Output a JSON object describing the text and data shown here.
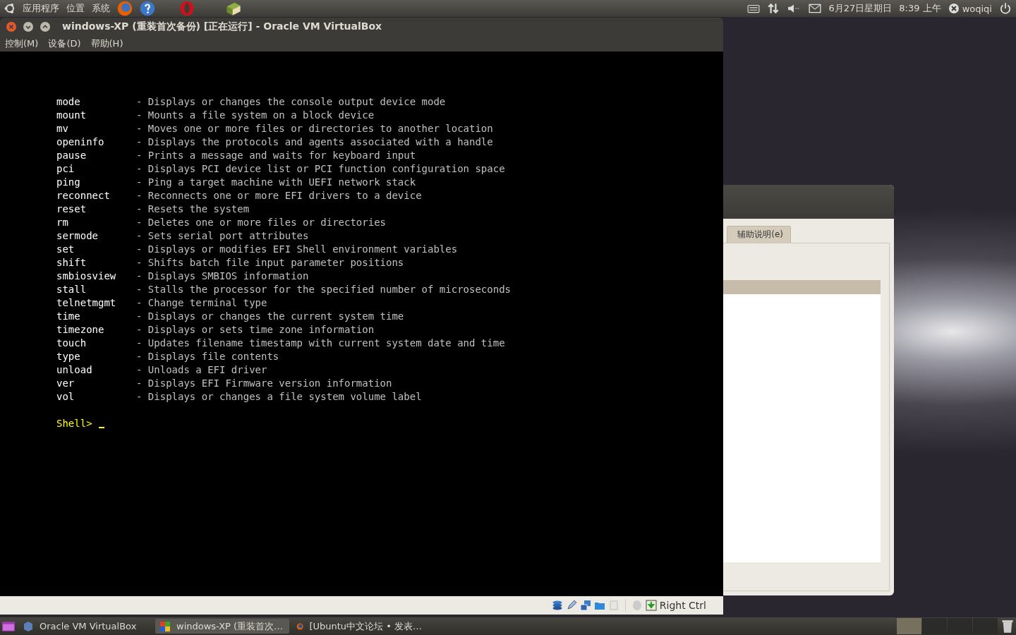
{
  "top_panel": {
    "menus": [
      "应用程序",
      "位置",
      "系统"
    ],
    "date": "6月27日星期日",
    "time": "8:39 上午",
    "user": "woqiqi"
  },
  "window": {
    "title": "windows-XP (重装首次备份) [正在运行] - Oracle VM VirtualBox",
    "menu": [
      "控制(M)",
      "设备(D)",
      "帮助(H)"
    ],
    "console": {
      "rows": [
        {
          "command": "mode",
          "description": "- Displays or changes the console output device mode"
        },
        {
          "command": "mount",
          "description": "- Mounts a file system on a block device"
        },
        {
          "command": "mv",
          "description": "- Moves one or more files or directories to another location"
        },
        {
          "command": "openinfo",
          "description": "- Displays the protocols and agents associated with a handle"
        },
        {
          "command": "pause",
          "description": "- Prints a message and waits for keyboard input"
        },
        {
          "command": "pci",
          "description": "- Displays PCI device list or PCI function configuration space"
        },
        {
          "command": "ping",
          "description": "- Ping a target machine with UEFI network stack"
        },
        {
          "command": "reconnect",
          "description": "- Reconnects one or more EFI drivers to a device"
        },
        {
          "command": "reset",
          "description": "- Resets the system"
        },
        {
          "command": "rm",
          "description": "- Deletes one or more files or directories"
        },
        {
          "command": "sermode",
          "description": "- Sets serial port attributes"
        },
        {
          "command": "set",
          "description": "- Displays or modifies EFI Shell environment variables"
        },
        {
          "command": "shift",
          "description": "- Shifts batch file input parameter positions"
        },
        {
          "command": "smbiosview",
          "description": "- Displays SMBIOS information"
        },
        {
          "command": "stall",
          "description": "- Stalls the processor for the specified number of microseconds"
        },
        {
          "command": "telnetmgmt",
          "description": "- Change terminal type"
        },
        {
          "command": "time",
          "description": "- Displays or changes the current system time"
        },
        {
          "command": "timezone",
          "description": "- Displays or sets time zone information"
        },
        {
          "command": "touch",
          "description": "- Updates filename timestamp with current system date and time"
        },
        {
          "command": "type",
          "description": "- Displays file contents"
        },
        {
          "command": "unload",
          "description": "- Unloads a EFI driver"
        },
        {
          "command": "ver",
          "description": "- Displays EFI Firmware version information"
        },
        {
          "command": "vol",
          "description": "- Displays or changes a file system volume label"
        }
      ],
      "prompt": "Shell>"
    },
    "status_bar": {
      "host_key": "Right Ctrl"
    }
  },
  "background_window": {
    "tab": "辅助说明(e)"
  },
  "taskbar": {
    "items": [
      {
        "label": "Oracle VM VirtualBox",
        "selected": false
      },
      {
        "label": "windows-XP (重装首次…",
        "selected": true
      },
      {
        "label": "[Ubuntu中文论坛 • 发表…",
        "selected": false
      }
    ],
    "workspaces": [
      {
        "selected": true
      },
      {
        "selected": false
      },
      {
        "selected": false
      },
      {
        "selected": false
      }
    ]
  }
}
